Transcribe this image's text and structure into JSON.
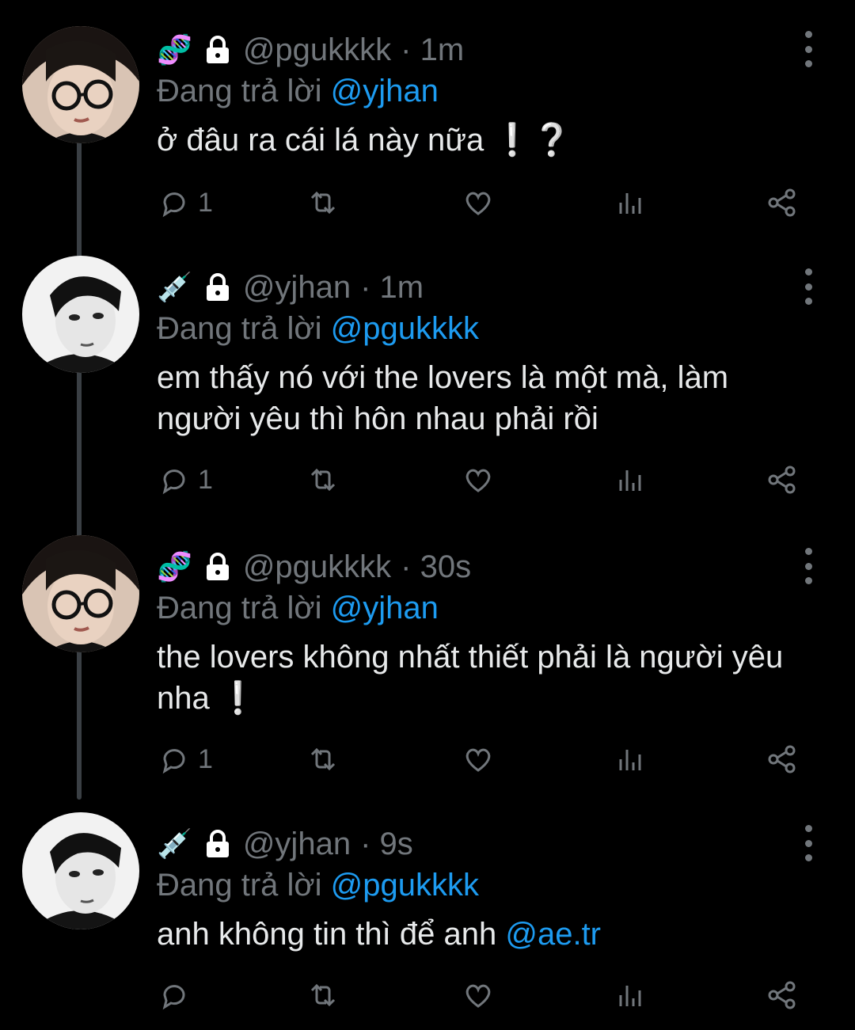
{
  "tweets": [
    {
      "emoji": "🧬",
      "handle": "@pgukkkk",
      "time": "· 1m",
      "reply_prefix": "Đang trả lời",
      "reply_to": "@yjhan",
      "body": "ở đâu ra cái lá này nữa ❕❔",
      "reply_count": "1",
      "avatar": "glasses-avatar"
    },
    {
      "emoji": "💉",
      "handle": "@yjhan",
      "time": "· 1m",
      "reply_prefix": "Đang trả lời",
      "reply_to": "@pgukkkk",
      "body": "em thấy nó với the lovers là một mà, làm người yêu thì hôn nhau phải rồi",
      "reply_count": "1",
      "avatar": "bw-avatar"
    },
    {
      "emoji": "🧬",
      "handle": "@pgukkkk",
      "time": "· 30s",
      "reply_prefix": "Đang trả lời",
      "reply_to": "@yjhan",
      "body": "the lovers không nhất thiết phải là người yêu nha ❕",
      "reply_count": "1",
      "avatar": "glasses-avatar"
    },
    {
      "emoji": "💉",
      "handle": "@yjhan",
      "time": "· 9s",
      "reply_prefix": "Đang trả lời",
      "reply_to": "@pgukkkk",
      "body": "anh không tin thì để anh ",
      "body_mention": "@ae.tr",
      "reply_count": "",
      "avatar": "bw-avatar"
    }
  ],
  "colors": {
    "background": "#000000",
    "muted": "#71767b",
    "accent": "#1d9bf0",
    "text": "#e7e9ea"
  }
}
